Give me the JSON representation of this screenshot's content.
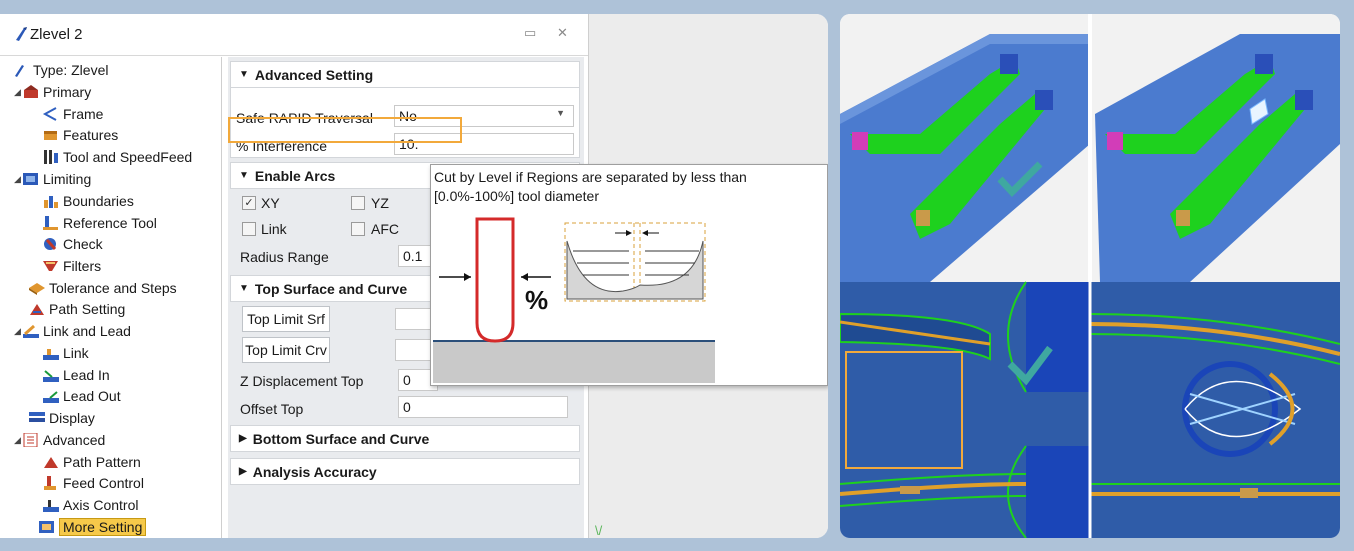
{
  "window": {
    "title": "Zlevel 2",
    "pin_icon": "pin-icon",
    "close_icon": "close-icon"
  },
  "tree": {
    "items": [
      {
        "label": "Type: Zlevel",
        "icon": "zlevel-icon"
      },
      {
        "label": "Primary",
        "icon": "primary-icon"
      },
      {
        "label": "Frame",
        "icon": "frame-icon"
      },
      {
        "label": "Features",
        "icon": "features-icon"
      },
      {
        "label": "Tool and SpeedFeed",
        "icon": "tool-icon"
      },
      {
        "label": "Limiting",
        "icon": "limiting-icon"
      },
      {
        "label": "Boundaries",
        "icon": "boundaries-icon"
      },
      {
        "label": "Reference Tool",
        "icon": "reference-tool-icon"
      },
      {
        "label": "Check",
        "icon": "check-icon"
      },
      {
        "label": "Filters",
        "icon": "filters-icon"
      },
      {
        "label": "Tolerance and Steps",
        "icon": "tolerance-icon"
      },
      {
        "label": "Path Setting",
        "icon": "path-setting-icon"
      },
      {
        "label": "Link and Lead",
        "icon": "link-lead-icon"
      },
      {
        "label": "Link",
        "icon": "link-icon"
      },
      {
        "label": "Lead In",
        "icon": "lead-in-icon"
      },
      {
        "label": "Lead Out",
        "icon": "lead-out-icon"
      },
      {
        "label": "Display",
        "icon": "display-icon"
      },
      {
        "label": "Advanced",
        "icon": "advanced-icon"
      },
      {
        "label": "Path Pattern",
        "icon": "path-pattern-icon"
      },
      {
        "label": "Feed Control",
        "icon": "feed-control-icon"
      },
      {
        "label": "Axis Control",
        "icon": "axis-control-icon"
      },
      {
        "label": "More Setting",
        "icon": "more-setting-icon",
        "selected": true
      }
    ]
  },
  "panel": {
    "advanced_setting": {
      "header": "Advanced Setting",
      "safe_rapid_label": "Safe RAPID Traversal",
      "safe_rapid_value": "No",
      "interference_label": "% Interference",
      "interference_value": "10."
    },
    "enable_arcs": {
      "header": "Enable Arcs",
      "xy_label": "XY",
      "xy_checked": true,
      "yz_label": "YZ",
      "yz_checked": false,
      "link_label": "Link",
      "link_checked": false,
      "afc_label": "AFC",
      "afc_checked": false,
      "radius_range_label": "Radius Range",
      "radius_range_value": "0.1"
    },
    "top_surface": {
      "header": "Top Surface and Curve",
      "top_limit_srf": "Top Limit Srf",
      "top_limit_crv": "Top Limit Crv",
      "z_disp_label": "Z Displacement Top",
      "z_disp_value": "0",
      "offset_top_label": "Offset Top",
      "offset_top_value": "0"
    },
    "bottom_surface": {
      "header": "Bottom Surface and Curve"
    },
    "analysis_accuracy": {
      "header": "Analysis Accuracy"
    }
  },
  "tooltip": {
    "text": "Cut by Level if Regions are separated by less than [0.0%-100%] tool diameter",
    "percent_symbol": "%"
  },
  "colors": {
    "highlight": "#f2a93b",
    "selected_bg": "#f6c94a",
    "tool_outline": "#d42a2a",
    "part_blue": "#3f6fc4",
    "toolpath_green": "#1ed11e",
    "check_teal": "#3fa8a0"
  }
}
